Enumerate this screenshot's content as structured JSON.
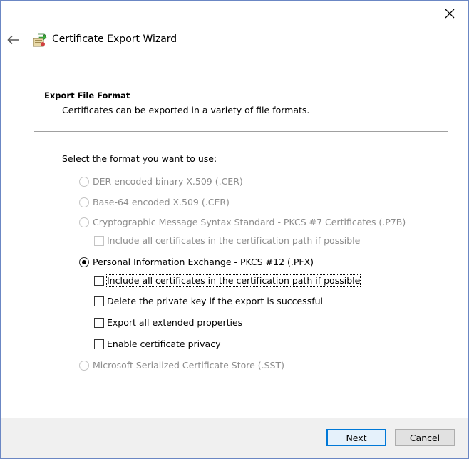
{
  "window": {
    "close_glyph": "✕"
  },
  "header": {
    "back_glyph": "←",
    "title": "Certificate Export Wizard",
    "icon": "certificate-wizard-icon"
  },
  "page": {
    "section_title": "Export File Format",
    "section_subtitle": "Certificates can be exported in a variety of file formats.",
    "prompt": "Select the format you want to use:"
  },
  "formats": [
    {
      "label": "DER encoded binary X.509 (.CER)",
      "selected": false,
      "enabled": false
    },
    {
      "label": "Base-64 encoded X.509 (.CER)",
      "selected": false,
      "enabled": false
    },
    {
      "label": "Cryptographic Message Syntax Standard - PKCS #7 Certificates (.P7B)",
      "selected": false,
      "enabled": false
    },
    {
      "label": "Personal Information Exchange - PKCS #12 (.PFX)",
      "selected": true,
      "enabled": true
    },
    {
      "label": "Microsoft Serialized Certificate Store (.SST)",
      "selected": false,
      "enabled": false
    }
  ],
  "p7b_options": [
    {
      "label": "Include all certificates in the certification path if possible",
      "checked": false,
      "enabled": false
    }
  ],
  "pfx_options": [
    {
      "label": "Include all certificates in the certification path if possible",
      "checked": false,
      "enabled": true,
      "focused": true
    },
    {
      "label": "Delete the private key if the export is successful",
      "checked": false,
      "enabled": true
    },
    {
      "label": "Export all extended properties",
      "checked": false,
      "enabled": true
    },
    {
      "label": "Enable certificate privacy",
      "checked": false,
      "enabled": true
    }
  ],
  "footer": {
    "next_label": "Next",
    "cancel_label": "Cancel"
  },
  "colors": {
    "accent": "#0078d7",
    "disabled_text": "#8c8c8c",
    "footer_bg": "#f0f0f0"
  }
}
